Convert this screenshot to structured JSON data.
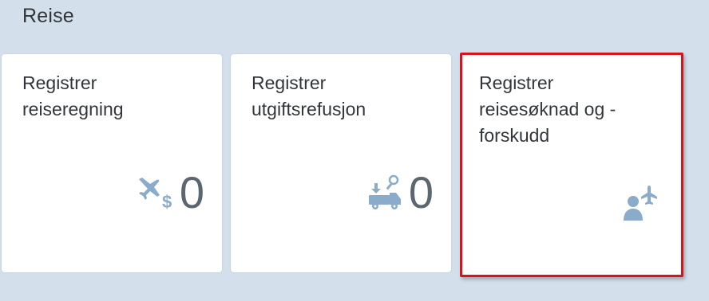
{
  "group": {
    "title": "Reise"
  },
  "tiles": [
    {
      "title_line1": "Registrer",
      "title_line2": "reiseregning",
      "value": "0",
      "icon": "travel-expense-icon"
    },
    {
      "title_line1": "Registrer",
      "title_line2": "utgiftsrefusjon",
      "value": "0",
      "icon": "expense-refund-icon"
    },
    {
      "title_line1": "Registrer",
      "title_line2": "reisesøknad og -",
      "title_line3": "forskudd",
      "icon": "person-travel-icon"
    }
  ],
  "colors": {
    "icon": "#8aabc9",
    "highlight": "#d9131a",
    "background": "#d3dfeb"
  }
}
